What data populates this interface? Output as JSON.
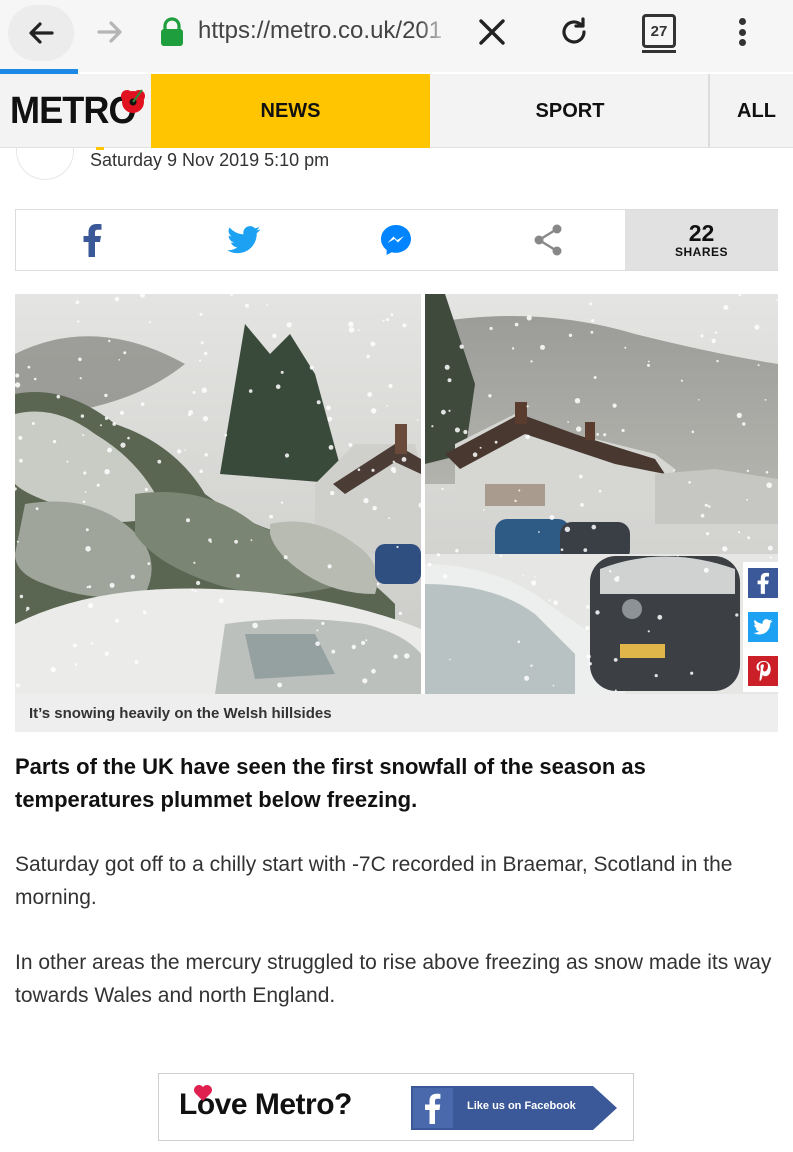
{
  "browser": {
    "url": "https://metro.co.uk/201",
    "tab_count": "27",
    "load_progress": 0.1
  },
  "site": {
    "logo": "METRO",
    "nav": {
      "news": "NEWS",
      "sport": "SPORT",
      "all": "ALL"
    },
    "accent_color": "#ffc501"
  },
  "article": {
    "date": "Saturday 9 Nov 2019 5:10 pm",
    "share_count": "22",
    "share_label": "SHARES",
    "share_icons": [
      "facebook-icon",
      "twitter-icon",
      "messenger-icon",
      "share-icon"
    ],
    "image_caption": "It’s snowing heavily on the Welsh hillsides",
    "lede": "Parts of the UK have seen the first snowfall of the season as temperatures plummet below freezing.",
    "paragraphs": [
      "Saturday got off to a chilly start with -7C recorded in Braemar, Scotland in the morning.",
      "In other areas the mercury struggled to rise above freezing as snow made its way towards Wales and north England."
    ]
  },
  "floating_share": {
    "icons": [
      "facebook-icon",
      "twitter-icon",
      "pinterest-icon"
    ],
    "colors": {
      "facebook": "#3b5998",
      "twitter": "#1da1f2",
      "pinterest": "#cb2027"
    }
  },
  "banner": {
    "text": "Love Metro?",
    "cta": "Like us on Facebook"
  }
}
